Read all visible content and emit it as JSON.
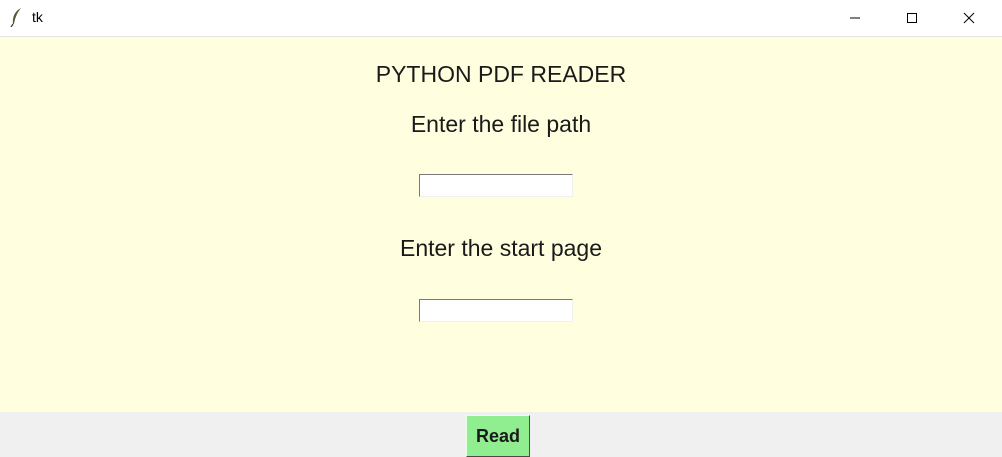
{
  "window": {
    "title": "tk",
    "icons": {
      "app": "feather-icon",
      "minimize": "minimize-icon",
      "maximize": "maximize-icon",
      "close": "close-icon"
    }
  },
  "main": {
    "app_title": "PYTHON PDF READER",
    "file_path_label": "Enter the file path",
    "file_path_value": "",
    "start_page_label": "Enter the start page",
    "start_page_value": ""
  },
  "footer": {
    "read_label": "Read"
  },
  "colors": {
    "content_background": "#ffffe0",
    "footer_background": "#f0f0f0",
    "read_button": "#90ee90"
  }
}
